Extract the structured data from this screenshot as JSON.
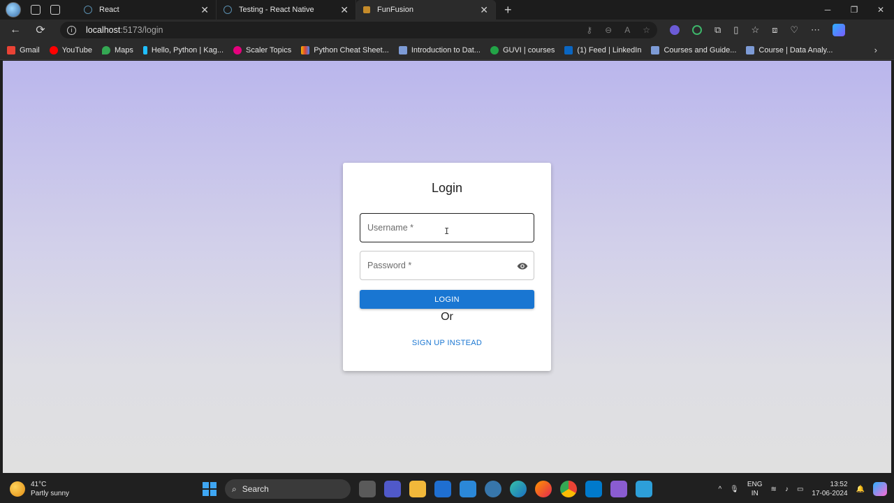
{
  "browser": {
    "tabs": [
      {
        "title": "React",
        "favicon": "react-icon"
      },
      {
        "title": "Testing - React Native",
        "favicon": "react-icon"
      },
      {
        "title": "FunFusion",
        "favicon": "funfusion-icon",
        "active": true
      }
    ],
    "url_host": "localhost",
    "url_path": ":5173/login",
    "bookmarks": [
      {
        "label": "Gmail",
        "icon": "gmail-icon",
        "color": "#ea4335"
      },
      {
        "label": "YouTube",
        "icon": "youtube-icon",
        "color": "#ff0000"
      },
      {
        "label": "Maps",
        "icon": "maps-icon",
        "color": "#34a853"
      },
      {
        "label": "Hello, Python | Kag...",
        "icon": "kaggle-icon",
        "color": "#20beff"
      },
      {
        "label": "Scaler Topics",
        "icon": "scaler-icon",
        "color": "#e5007d"
      },
      {
        "label": "Python Cheat Sheet...",
        "icon": "cheatsheet-icon",
        "color": "#f4b400"
      },
      {
        "label": "Introduction to Dat...",
        "icon": "course-icon",
        "color": "#7d9bd6"
      },
      {
        "label": "GUVI | courses",
        "icon": "guvi-icon",
        "color": "#22a447"
      },
      {
        "label": "(1) Feed | LinkedIn",
        "icon": "linkedin-icon",
        "color": "#0a66c2"
      },
      {
        "label": "Courses and Guide...",
        "icon": "course-icon",
        "color": "#7d9bd6"
      },
      {
        "label": "Course | Data Analy...",
        "icon": "course-icon",
        "color": "#7d9bd6"
      }
    ]
  },
  "login": {
    "title": "Login",
    "username_placeholder": "Username *",
    "password_placeholder": "Password *",
    "login_label": "LOGIN",
    "or_text": "Or",
    "signup_label": "SIGN UP INSTEAD",
    "accent_color": "#1976d2"
  },
  "taskbar": {
    "temperature": "41°C",
    "weather": "Partly sunny",
    "search_label": "Search",
    "lang_top": "ENG",
    "lang_bottom": "IN",
    "time": "13:52",
    "date": "17-06-2024"
  }
}
